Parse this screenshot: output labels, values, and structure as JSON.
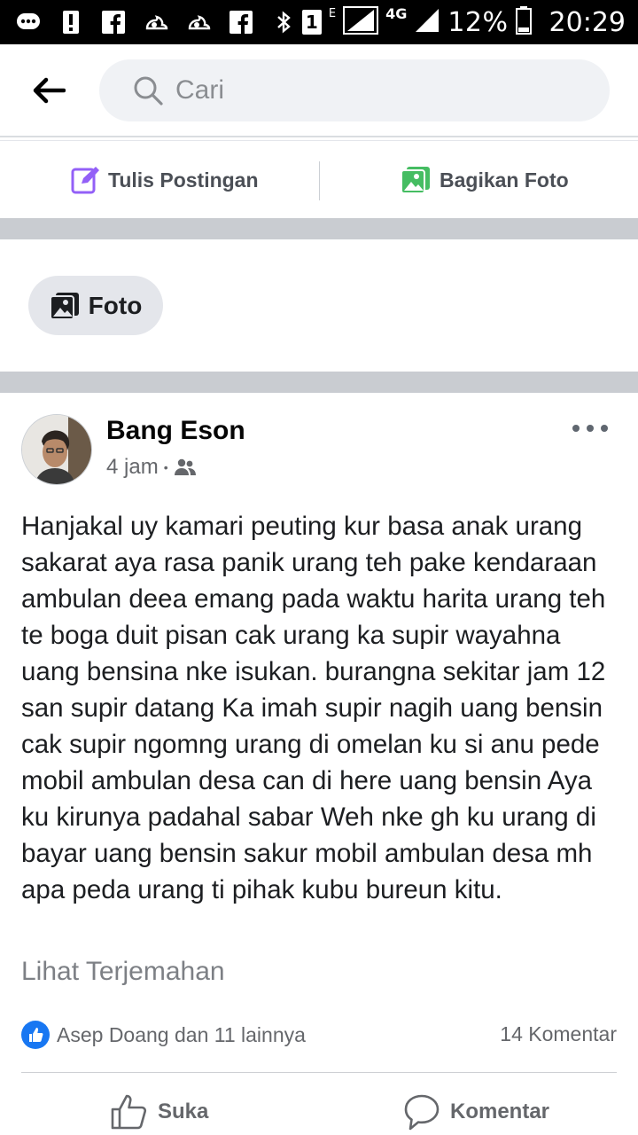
{
  "status_bar": {
    "battery_percent": "12%",
    "time": "20:29",
    "network": "4G",
    "sim_slot": "1",
    "edge_label": "E",
    "notification_icons": [
      "chat-icon",
      "alert-icon",
      "facebook-icon",
      "uc-browser-icon",
      "uc-browser-icon",
      "facebook-icon",
      "bluetooth-icon"
    ]
  },
  "header": {
    "search_placeholder": "Cari"
  },
  "composer": {
    "write_label": "Tulis Postingan",
    "share_photo_label": "Bagikan Foto"
  },
  "filter": {
    "photo_chip_label": "Foto"
  },
  "post": {
    "author": "Bang Eson",
    "time": "4 jam",
    "separator": "•",
    "audience_icon": "friends-icon",
    "text": "Hanjakal uy kamari peuting kur basa anak urang sakarat aya rasa panik urang teh pake kendaraan ambulan deea emang pada waktu harita urang teh te boga duit pisan cak urang ka supir wayahna uang bensina nke isukan. burangna sekitar jam 12 san supir datang Ka imah supir nagih uang bensin cak supir ngomng urang di omelan ku si anu pede mobil ambulan desa can di here uang bensin Aya ku kirunya padahal sabar Weh nke gh ku urang di bayar uang bensin sakur mobil ambulan desa mh apa peda urang ti pihak kubu bureun kitu.",
    "translate_label": "Lihat Terjemahan",
    "reactions_text": "Asep Doang dan 11 lainnya",
    "comments_count": "14 Komentar",
    "like_label": "Suka",
    "comment_label": "Komentar"
  },
  "colors": {
    "accent": "#1877f2",
    "write_icon": "#9360f7",
    "photo_icon": "#45bd62",
    "separator_bar": "#c9ccd1",
    "status_bar": "#000000"
  }
}
